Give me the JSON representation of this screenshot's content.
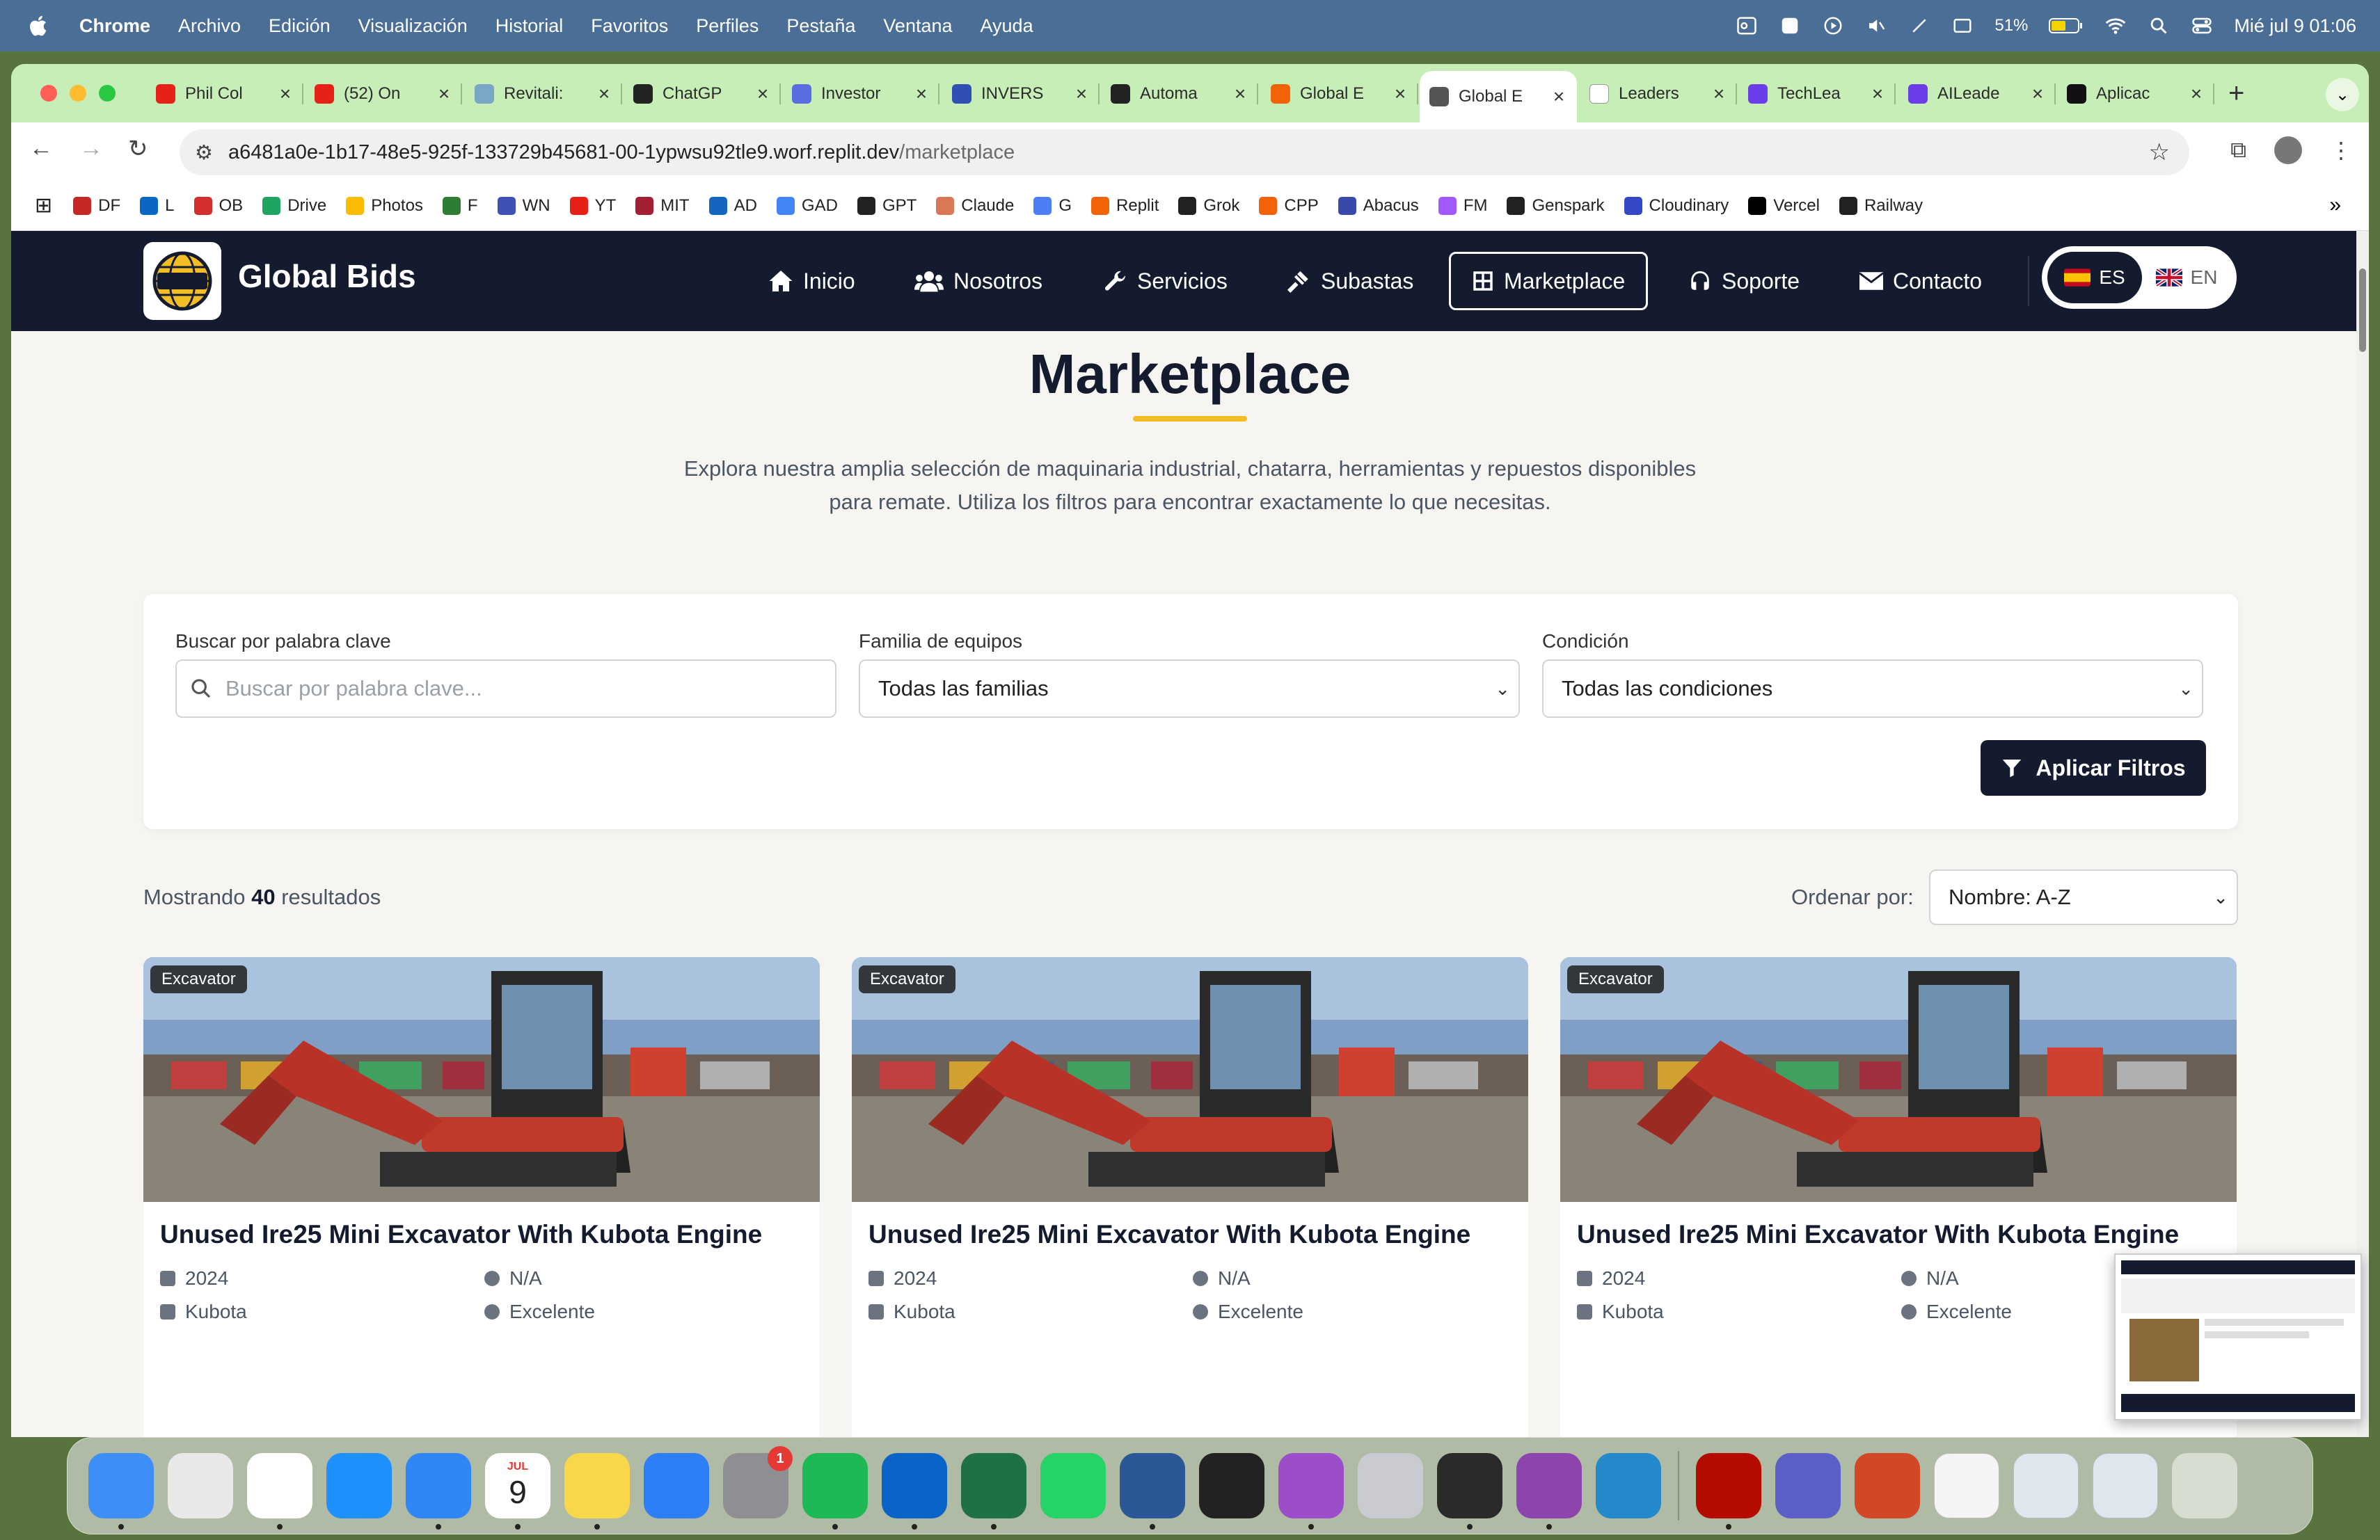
{
  "menubar": {
    "items": [
      "Chrome",
      "Archivo",
      "Edición",
      "Visualización",
      "Historial",
      "Favoritos",
      "Perfiles",
      "Pestaña",
      "Ventana",
      "Ayuda"
    ],
    "battery": "51%",
    "datetime": "Mié jul 9  01:06"
  },
  "tabs": [
    {
      "label": "Phil Col",
      "icon": "youtube-icon",
      "color": "#e62117"
    },
    {
      "label": "(52) On",
      "icon": "youtube-icon",
      "color": "#e62117"
    },
    {
      "label": "Revitali:",
      "icon": "revitalize-icon",
      "color": "#7aa7c7"
    },
    {
      "label": "ChatGP",
      "icon": "openai-icon",
      "color": "#222222"
    },
    {
      "label": "Investor",
      "icon": "investor-icon",
      "color": "#5b6ee1"
    },
    {
      "label": "INVERS",
      "icon": "invers-icon",
      "color": "#2f4fb4"
    },
    {
      "label": "Automa",
      "icon": "openai-icon",
      "color": "#222222"
    },
    {
      "label": "Global E",
      "icon": "replit-icon",
      "color": "#f26207"
    },
    {
      "label": "Global E",
      "icon": "globe-icon",
      "color": "#555555",
      "active": true
    },
    {
      "label": "Leaders",
      "icon": "ll-icon",
      "color": "#ffffff"
    },
    {
      "label": "TechLea",
      "icon": "techlead-icon",
      "color": "#6a3de8"
    },
    {
      "label": "AILeade",
      "icon": "aileader-icon",
      "color": "#6a3de8"
    },
    {
      "label": "Aplicac",
      "icon": "app-icon",
      "color": "#111111"
    }
  ],
  "address": {
    "host": "a6481a0e-1b17-48e5-925f-133729b45681-00-1ypwsu92tle9.worf.replit.dev",
    "path": "/marketplace"
  },
  "bookmarks": [
    {
      "label": "DF",
      "color": "#c62828"
    },
    {
      "label": "L",
      "color": "#0a66c2"
    },
    {
      "label": "OB",
      "color": "#d32f2f"
    },
    {
      "label": "Drive",
      "color": "#1fa463"
    },
    {
      "label": "Photos",
      "color": "#fbbc04"
    },
    {
      "label": "F",
      "color": "#2e7d32"
    },
    {
      "label": "WN",
      "color": "#3f51b5"
    },
    {
      "label": "YT",
      "color": "#e62117"
    },
    {
      "label": "MIT",
      "color": "#a31f34"
    },
    {
      "label": "AD",
      "color": "#1565c0"
    },
    {
      "label": "GAD",
      "color": "#4285f4"
    },
    {
      "label": "GPT",
      "color": "#222222"
    },
    {
      "label": "Claude",
      "color": "#d97757"
    },
    {
      "label": "G",
      "color": "#4f7df3"
    },
    {
      "label": "Replit",
      "color": "#f26207"
    },
    {
      "label": "Grok",
      "color": "#222222"
    },
    {
      "label": "CPP",
      "color": "#f26207"
    },
    {
      "label": "Abacus",
      "color": "#3949ab"
    },
    {
      "label": "FM",
      "color": "#a259ff"
    },
    {
      "label": "Genspark",
      "color": "#222222"
    },
    {
      "label": "Cloudinary",
      "color": "#3448c5"
    },
    {
      "label": "Vercel",
      "color": "#000000"
    },
    {
      "label": "Railway",
      "color": "#222222"
    }
  ],
  "site": {
    "brand": "Global Bids",
    "nav": [
      "Inicio",
      "Nosotros",
      "Servicios",
      "Subastas",
      "Marketplace",
      "Soporte",
      "Contacto"
    ],
    "active_nav": "Marketplace",
    "lang": {
      "es": "ES",
      "en": "EN"
    }
  },
  "hero": {
    "title": "Marketplace",
    "line1": "Explora nuestra amplia selección de maquinaria industrial, chatarra, herramientas y repuestos disponibles",
    "line2": "para remate. Utiliza los filtros para encontrar exactamente lo que necesitas."
  },
  "filters": {
    "keyword_label": "Buscar por palabra clave",
    "keyword_placeholder": "Buscar por palabra clave...",
    "family_label": "Familia de equipos",
    "family_value": "Todas las familias",
    "condition_label": "Condición",
    "condition_value": "Todas las condiciones",
    "apply": "Aplicar Filtros"
  },
  "results": {
    "prefix": "Mostrando",
    "count": "40",
    "suffix": "resultados",
    "sort_label": "Ordenar por:",
    "sort_value": "Nombre: A-Z"
  },
  "cards": [
    {
      "badge": "Excavator",
      "title": "Unused Ire25 Mini Excavator With Kubota Engine",
      "year": "2024",
      "hours": "N/A",
      "brand": "Kubota",
      "condition": "Excelente"
    },
    {
      "badge": "Excavator",
      "title": "Unused Ire25 Mini Excavator With Kubota Engine",
      "year": "2024",
      "hours": "N/A",
      "brand": "Kubota",
      "condition": "Excelente"
    },
    {
      "badge": "Excavator",
      "title": "Unused Ire25 Mini Excavator With Kubota Engine",
      "year": "2024",
      "hours": "N/A",
      "brand": "Kubota",
      "condition": "Excelente"
    }
  ],
  "dock": {
    "apps": [
      {
        "name": "finder-icon",
        "color": "#3e8ef7"
      },
      {
        "name": "launchpad-icon",
        "color": "#e8e8e8"
      },
      {
        "name": "chrome-icon",
        "color": "#ffffff"
      },
      {
        "name": "safari-icon",
        "color": "#1e90ff"
      },
      {
        "name": "mail-icon",
        "color": "#2f86f6"
      },
      {
        "name": "calendar-icon",
        "color": "#ffffff"
      },
      {
        "name": "notes-icon",
        "color": "#f8d74a"
      },
      {
        "name": "keynote-icon",
        "color": "#2d7ef7"
      },
      {
        "name": "settings-icon",
        "color": "#8e8e93"
      },
      {
        "name": "spotify-icon",
        "color": "#1db954"
      },
      {
        "name": "outlook-icon",
        "color": "#0a64c8"
      },
      {
        "name": "excel-icon",
        "color": "#1e7145"
      },
      {
        "name": "whatsapp-icon",
        "color": "#25d366"
      },
      {
        "name": "word-icon",
        "color": "#2b5797"
      },
      {
        "name": "fantastical-icon",
        "color": "#222222"
      },
      {
        "name": "circle-app-icon",
        "color": "#9b4dca"
      },
      {
        "name": "iphone-mirroring-icon",
        "color": "#c9cbd0"
      },
      {
        "name": "replit-icon",
        "color": "#2a2a2a"
      },
      {
        "name": "github-icon",
        "color": "#8e44ad"
      },
      {
        "name": "vscode-icon",
        "color": "#2489ca"
      },
      {
        "name": "acrobat-icon",
        "color": "#b30b00"
      },
      {
        "name": "teams-icon",
        "color": "#5b5fc7"
      },
      {
        "name": "powerpoint-icon",
        "color": "#d24726"
      }
    ],
    "calendar_month": "JUL",
    "calendar_day": "9",
    "settings_badge": "1"
  }
}
